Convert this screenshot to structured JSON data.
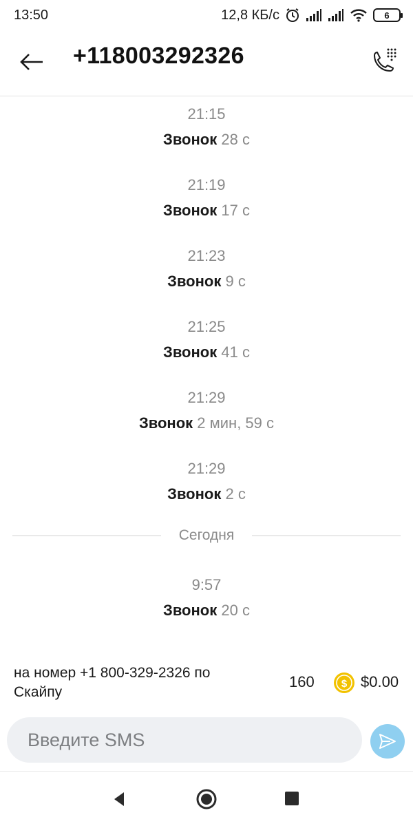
{
  "status_bar": {
    "time": "13:50",
    "network_speed": "12,8 КБ/с",
    "battery_level": "6",
    "icons": [
      "alarm-icon",
      "signal-icon",
      "signal-icon",
      "wifi-icon",
      "battery-icon"
    ]
  },
  "header": {
    "title": "+118003292326",
    "back_icon": "arrow-left-icon",
    "call_icon": "dialpad-phone-icon"
  },
  "messages": [
    {
      "time": "21:15",
      "label": "Звонок",
      "duration": "28 с"
    },
    {
      "time": "21:19",
      "label": "Звонок",
      "duration": "17 с"
    },
    {
      "time": "21:23",
      "label": "Звонок",
      "duration": "9 с"
    },
    {
      "time": "21:25",
      "label": "Звонок",
      "duration": "41 с"
    },
    {
      "time": "21:29",
      "label": "Звонок",
      "duration": "2 мин, 59 с"
    },
    {
      "time": "21:29",
      "label": "Звонок",
      "duration": "2 с"
    }
  ],
  "separator": {
    "label": "Сегодня"
  },
  "today_messages": [
    {
      "time": "9:57",
      "label": "Звонок",
      "duration": "20 с"
    }
  ],
  "info": {
    "text": "на номер +1 800-329-2326 по Скайпу",
    "sms_count": "160",
    "balance": "$0.00",
    "coin_color": "#f2c200"
  },
  "input": {
    "placeholder": "Введите SMS",
    "value": ""
  },
  "colors": {
    "send_button": "#8fcff0",
    "muted_text": "#8a8a8a"
  }
}
